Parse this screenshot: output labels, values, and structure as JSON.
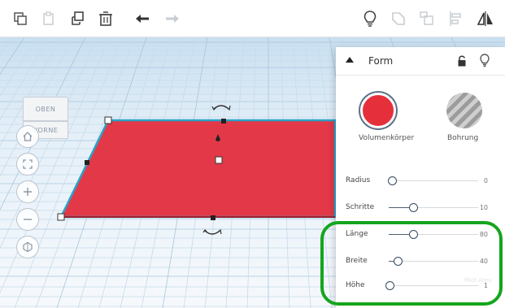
{
  "toolbar": {
    "left_icons": [
      "copy-icon",
      "paste-icon",
      "duplicate-icon",
      "trash-icon",
      "undo-icon",
      "redo-icon"
    ],
    "right_icons": [
      "lightbulb-icon",
      "group-icon",
      "ungroup-icon",
      "align-icon",
      "mirror-icon"
    ]
  },
  "viewcube": {
    "top": "OBEN",
    "front": "VORNE"
  },
  "nav_icons": [
    "home-icon",
    "fit-all-icon",
    "zoom-in-icon",
    "zoom-out-icon",
    "view-mode-icon"
  ],
  "shape": {
    "color": "#e23848",
    "outline": "#2aa3c8"
  },
  "inspector": {
    "title": "Form",
    "solid_label": "Volumenkörper",
    "hole_label": "Bohrung",
    "properties": [
      {
        "label": "Radius",
        "value": "0",
        "fraction": 0.04
      },
      {
        "label": "Schritte",
        "value": "10",
        "fraction": 0.27
      },
      {
        "label": "Länge",
        "value": "80",
        "fraction": 0.27
      },
      {
        "label": "Breite",
        "value": "40",
        "fraction": 0.1
      },
      {
        "label": "Höhe",
        "value": "1",
        "fraction": 0.01
      }
    ],
    "ghost_text": "Pilot Area"
  },
  "colors": {
    "highlight": "#15a51d",
    "accent": "#4d5f73"
  }
}
